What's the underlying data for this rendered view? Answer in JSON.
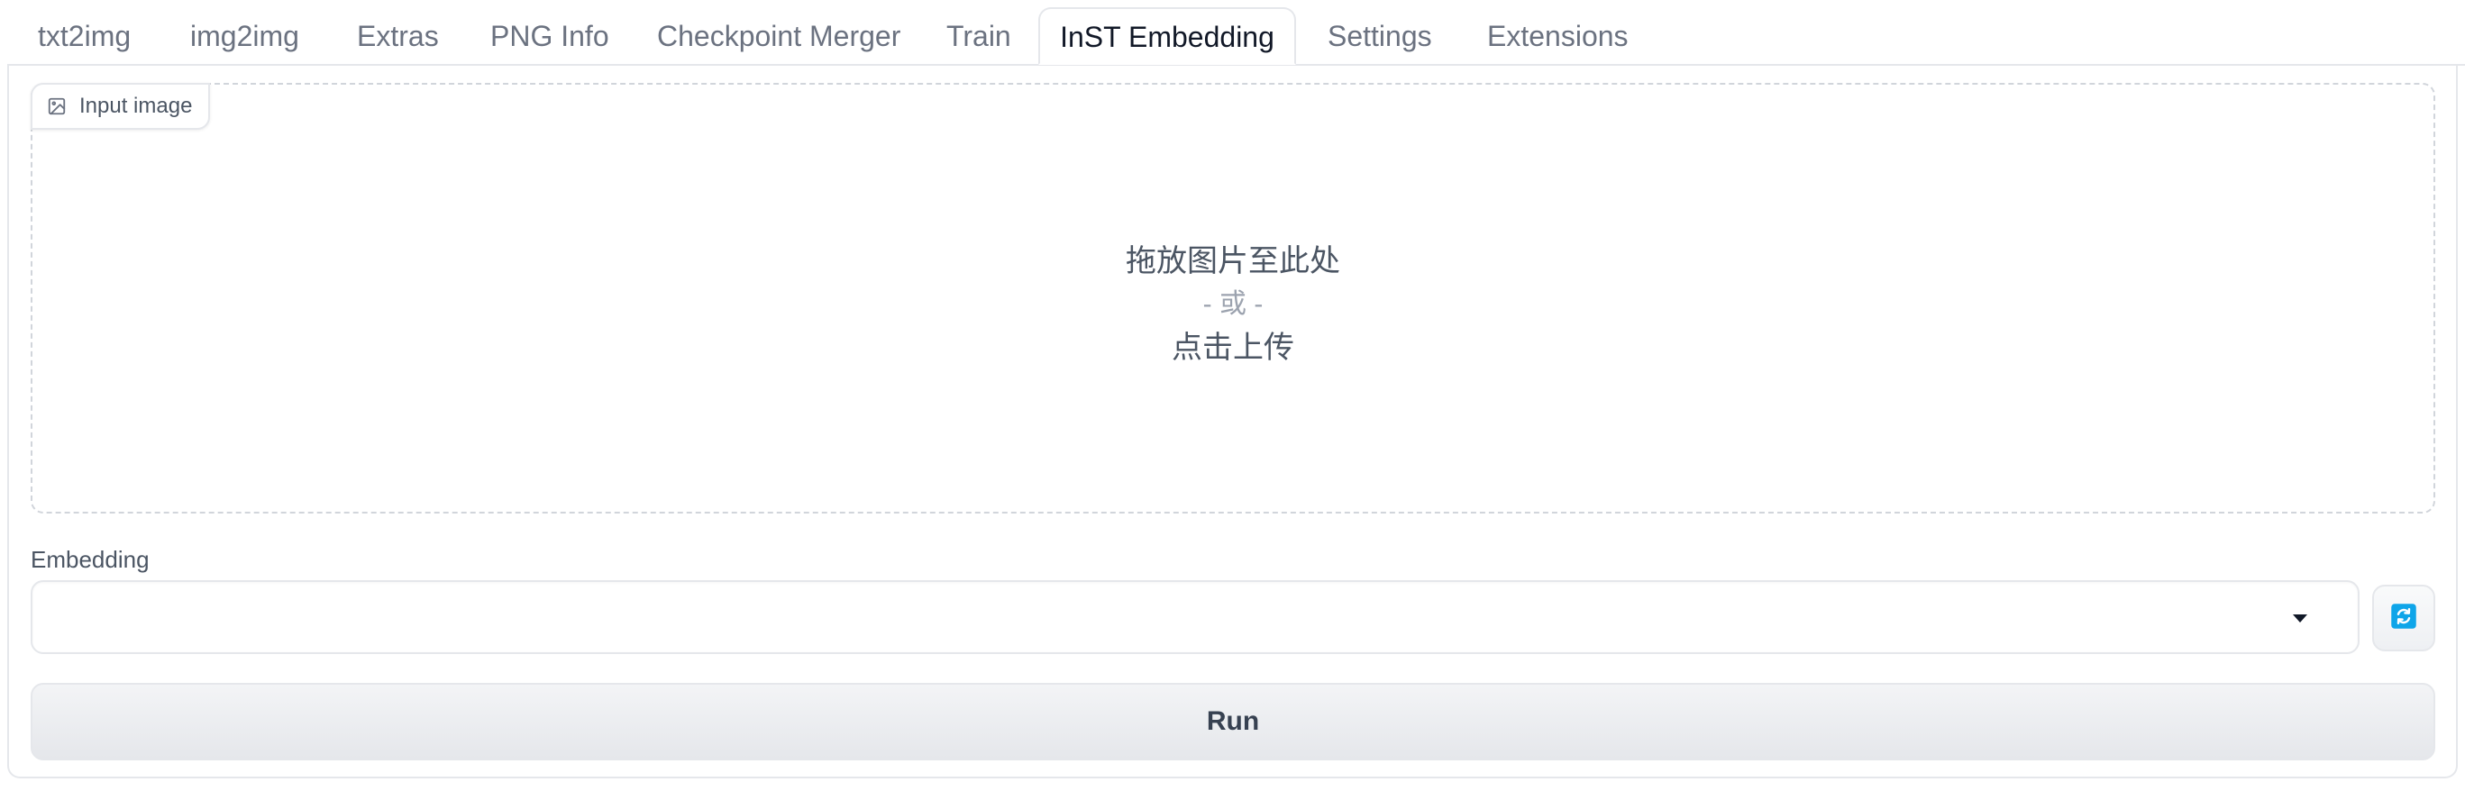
{
  "tabs": [
    {
      "label": "txt2img"
    },
    {
      "label": "img2img"
    },
    {
      "label": "Extras"
    },
    {
      "label": "PNG Info"
    },
    {
      "label": "Checkpoint Merger"
    },
    {
      "label": "Train"
    },
    {
      "label": "InST Embedding",
      "selected": true
    },
    {
      "label": "Settings"
    },
    {
      "label": "Extensions"
    }
  ],
  "image_input": {
    "label": "Input image",
    "icon": "image-icon",
    "drop_text": "拖放图片至此处",
    "or_text": "- 或 -",
    "click_text": "点击上传"
  },
  "embedding": {
    "label": "Embedding",
    "value": "",
    "refresh_icon": "refresh-icon",
    "refresh_color": "#0ea5e9"
  },
  "run_button": {
    "label": "Run"
  }
}
